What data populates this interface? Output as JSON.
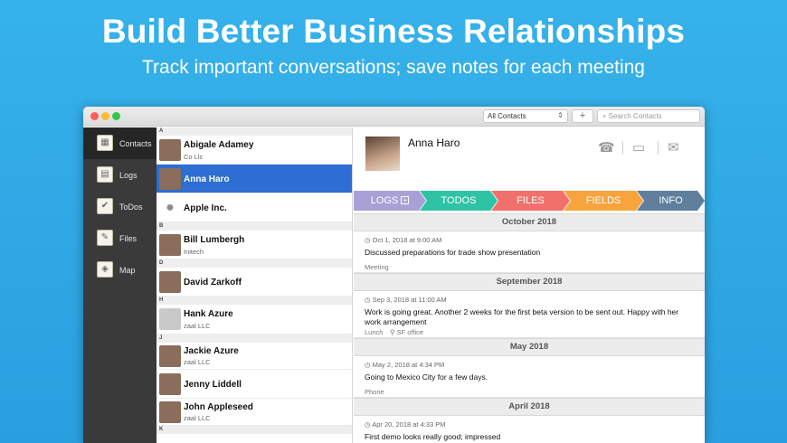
{
  "banner": {
    "headline": "Build Better Business Relationships",
    "subline": "Track important conversations; save notes for each meeting"
  },
  "toolbar": {
    "filter_value": "All Contacts",
    "add_label": "+",
    "search_placeholder": "Search Contacts"
  },
  "sidebar": {
    "items": [
      {
        "label": "Contacts",
        "icon": "contacts-card-icon",
        "glyph": "▦",
        "active": true
      },
      {
        "label": "Logs",
        "icon": "logs-book-icon",
        "glyph": "▤"
      },
      {
        "label": "ToDos",
        "icon": "todo-check-icon",
        "glyph": "✔"
      },
      {
        "label": "Files",
        "icon": "paperclip-icon",
        "glyph": "✎"
      },
      {
        "label": "Map",
        "icon": "map-icon",
        "glyph": "◈"
      }
    ]
  },
  "contacts": {
    "letters": [
      "A",
      "B",
      "D",
      "H",
      "J",
      "K"
    ],
    "rows": [
      {
        "name": "Abigale Adamey",
        "sub": "Co Llc"
      },
      {
        "name": "Anna Haro",
        "sub": ""
      },
      {
        "name": "Apple Inc.",
        "sub": ""
      },
      {
        "name": "Bill Lumbergh",
        "sub": "Initech"
      },
      {
        "name": "David Zarkoff",
        "sub": ""
      },
      {
        "name": "Hank Azure",
        "sub": "zaal LLC"
      },
      {
        "name": "Jackie Azure",
        "sub": "zaal LLC"
      },
      {
        "name": "Jenny Liddell",
        "sub": ""
      },
      {
        "name": "John Appleseed",
        "sub": "zaal LLC"
      }
    ]
  },
  "detail": {
    "name": "Anna Haro",
    "tabs": [
      "LOGS",
      "TODOS",
      "FILES",
      "FIELDS",
      "INFO"
    ],
    "tab_plus": "+",
    "months": [
      "October 2018",
      "September 2018",
      "May 2018",
      "April 2018"
    ],
    "entries": [
      {
        "date": "Oct 1, 2018 at 9:00 AM",
        "text": "Discussed preparations for trade show presentation",
        "tag": "Meeting",
        "location": ""
      },
      {
        "date": "Sep 3, 2018 at 11:00 AM",
        "text": "Work is going great. Another 2 weeks for the first beta version to be sent out. Happy with her work arrangement",
        "tag": "Lunch",
        "location": "SF office"
      },
      {
        "date": "May 2, 2018 at 4:34 PM",
        "text": "Going to Mexico City for a few days.",
        "tag": "Phone",
        "location": ""
      },
      {
        "date": "Apr 20, 2018 at 4:33 PM",
        "text": "First demo looks really good; impressed",
        "tag": "",
        "location": ""
      }
    ]
  },
  "colors": {
    "background": "#2fa8e6",
    "selection": "#2c6ed1",
    "tab_logs": "#a9a0d6",
    "tab_todos": "#2fc3a6",
    "tab_files": "#f2706b",
    "tab_fields": "#f7a43e",
    "tab_info": "#5f7f9d"
  }
}
